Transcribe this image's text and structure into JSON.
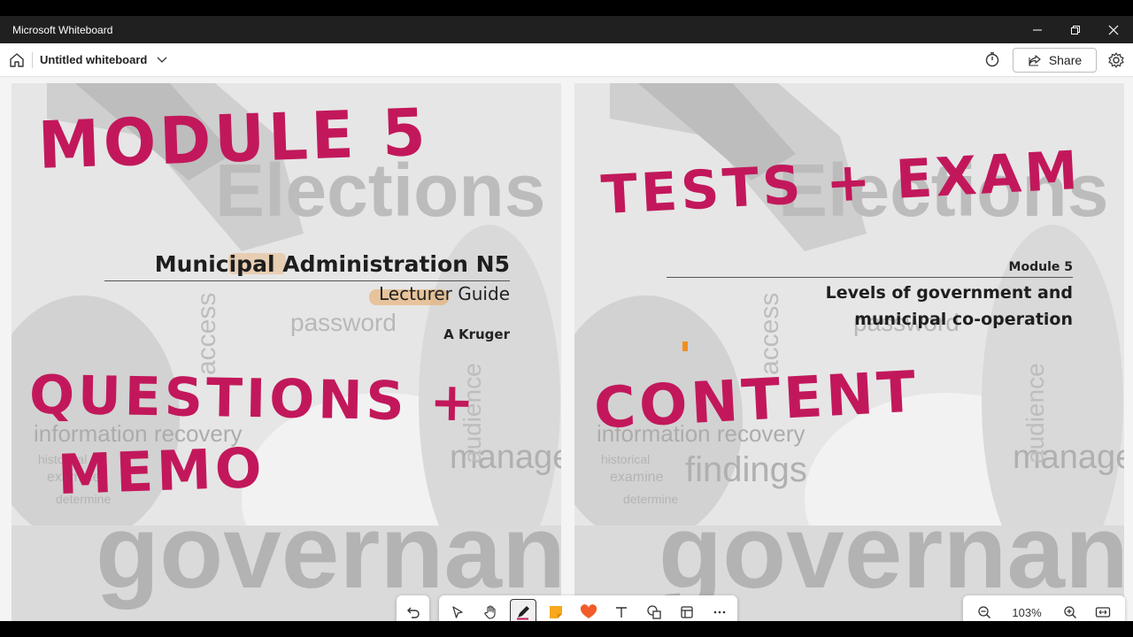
{
  "window": {
    "title": "Microsoft Whiteboard"
  },
  "header": {
    "doc_title": "Untitled whiteboard",
    "share_label": "Share"
  },
  "left_slide": {
    "course_title": "Municipal Administration N5",
    "subtitle": "Lecturer Guide",
    "author": "A Kruger",
    "ink_top": "MODULE 5",
    "ink_mid": "QUESTIONS +",
    "ink_bottom": "MEMO"
  },
  "right_slide": {
    "module_label": "Module 5",
    "title": "Levels of government and municipal co-operation",
    "ink_top": "TESTS + EXAM",
    "ink_mid": "CONTENT"
  },
  "background_words": {
    "big": "governance",
    "sign": "Elections",
    "w1": "password",
    "w2": "information recovery",
    "w3": "manager",
    "w4": "access",
    "w5": "historical",
    "w6": "examine",
    "w7": "findings",
    "w8": "audience",
    "w9": "determine"
  },
  "toolbar": {
    "undo_icon": "undo-icon",
    "tools": [
      "select-icon",
      "hand-icon",
      "pen-icon",
      "sticky-note-icon",
      "reaction-icon",
      "text-icon",
      "shapes-icon",
      "template-icon",
      "more-icon"
    ]
  },
  "zoom": {
    "level": "103%"
  },
  "colors": {
    "ink": "#c2185b",
    "sticky": "#f7a81b",
    "reaction": "#f25c2a",
    "accent_highlight": "#e8a050"
  }
}
